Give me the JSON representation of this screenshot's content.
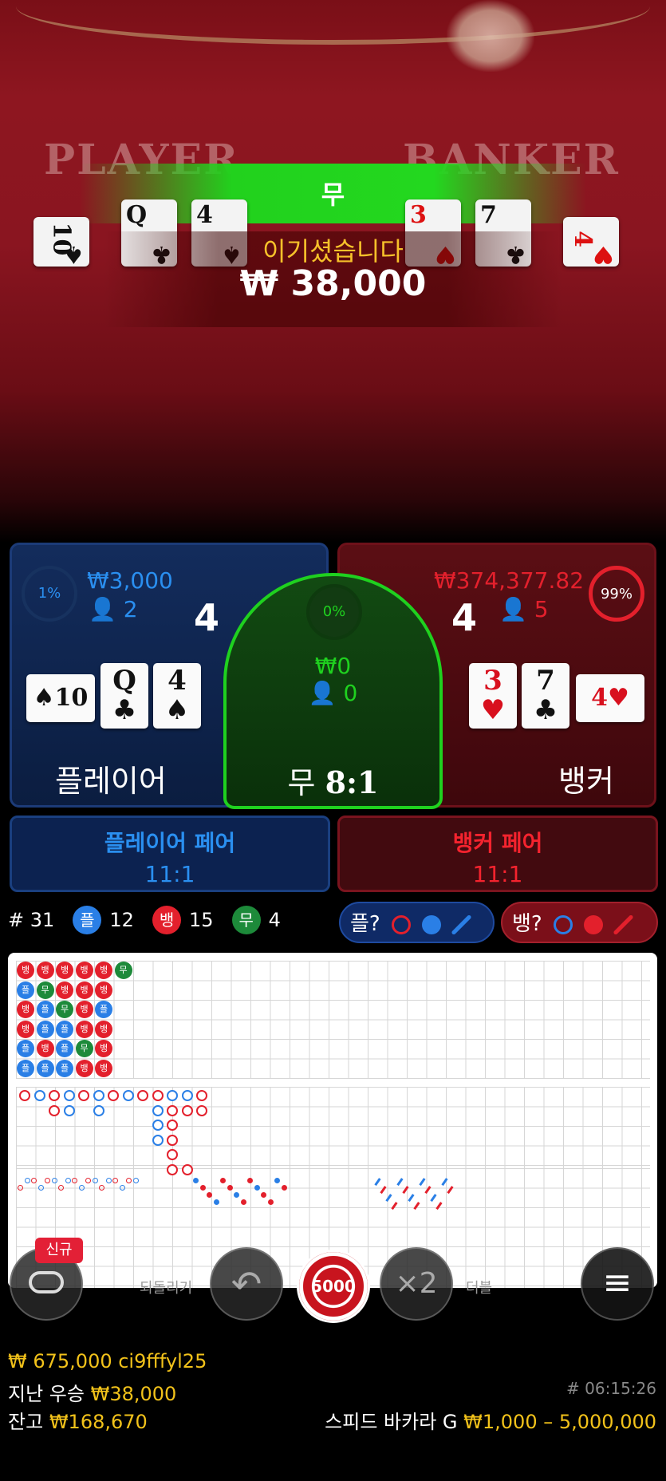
{
  "video": {
    "felt_player": "PLAYER",
    "felt_banker": "BANKER",
    "result_banner": "무",
    "win_message": "이기셨습니다",
    "win_amount": "₩ 38,000",
    "cards": [
      {
        "rank": "10",
        "suit": "♠",
        "color": "black"
      },
      {
        "rank": "Q",
        "suit": "♣",
        "color": "black"
      },
      {
        "rank": "4",
        "suit": "♠",
        "color": "black"
      },
      {
        "rank": "3",
        "suit": "♥",
        "color": "red"
      },
      {
        "rank": "7",
        "suit": "♣",
        "color": "black"
      },
      {
        "rank": "4",
        "suit": "♥",
        "color": "red"
      }
    ]
  },
  "player": {
    "percent": "1%",
    "amount": "₩3,000",
    "bettors": "2",
    "score": "4",
    "label": "플레이어",
    "cards": [
      {
        "rank": "10",
        "suit": "♠"
      },
      {
        "rank": "Q",
        "suit": "♣"
      },
      {
        "rank": "4",
        "suit": "♠"
      }
    ]
  },
  "tie": {
    "percent": "0%",
    "amount": "₩0",
    "bettors": "0",
    "label": "무 ",
    "odds": "8:1"
  },
  "banker": {
    "percent": "99%",
    "amount": "₩374,377.82",
    "bettors": "5",
    "score": "4",
    "label": "뱅커",
    "cards": [
      {
        "rank": "3",
        "suit": "♥"
      },
      {
        "rank": "7",
        "suit": "♣"
      },
      {
        "rank": "4",
        "suit": "♥"
      }
    ]
  },
  "player_pair": {
    "title": "플레이어 페어",
    "odds": "11:1"
  },
  "banker_pair": {
    "title": "뱅커 페어",
    "odds": "11:1"
  },
  "stats": {
    "round": "# 31",
    "player_char": "플",
    "player_count": "12",
    "banker_char": "뱅",
    "banker_count": "15",
    "tie_char": "무",
    "tie_count": "4",
    "predict_player": "플?",
    "predict_banker": "뱅?"
  },
  "bead_road": [
    [
      "B",
      "P",
      "B",
      "B",
      "P",
      "P"
    ],
    [
      "B",
      "T",
      "P",
      "P",
      "B",
      "P"
    ],
    [
      "B",
      "B",
      "T",
      "P",
      "P",
      "P"
    ],
    [
      "B",
      "B",
      "B",
      "B",
      "T",
      "B"
    ],
    [
      "B",
      "B",
      "P",
      "B",
      "B",
      "B"
    ],
    [
      "T"
    ]
  ],
  "controls": {
    "new_badge": "신규",
    "undo_label": "되돌리기",
    "chip_value": "5000",
    "double_label": "×2",
    "repeat_label": "더블"
  },
  "footer": {
    "balance_user": "₩ 675,000 ci9fffyl25",
    "last_win_label": "지난 우승",
    "last_win": "₩38,000",
    "balance_label": "잔고",
    "balance": "₩168,670",
    "game_id": "# 06:15:26",
    "table_name": "스피드 바카라 G",
    "limits": "₩1,000 – 5,000,000"
  },
  "colors": {
    "player_blue": "#2a8ff0",
    "banker_red": "#e3202c",
    "tie_green": "#1fd11f",
    "gold": "#f2c21a"
  }
}
